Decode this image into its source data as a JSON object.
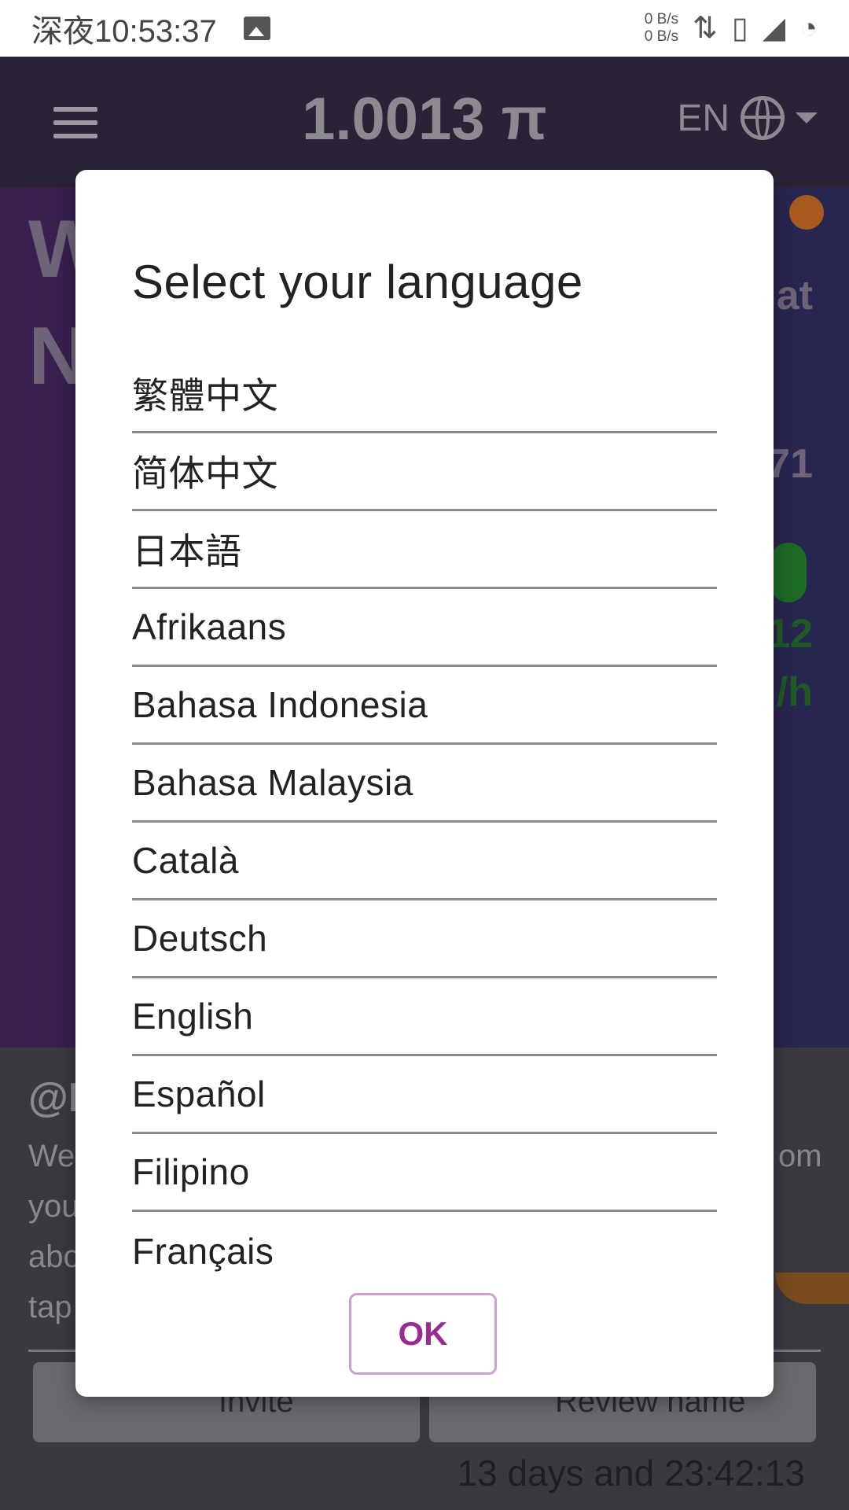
{
  "status_bar": {
    "time": "深夜10:53:37",
    "speed_up": "0 B/s",
    "speed_down": "0 B/s"
  },
  "header": {
    "balance": "1.0013 π",
    "language_code": "EN"
  },
  "background": {
    "big_line1": "W",
    "big_line2": "N",
    "side_chat": "at",
    "side_count": "71",
    "side_rate_value": "12",
    "side_rate_unit": "/h",
    "username_partial": "@P",
    "body_line1_left": "We",
    "body_line1_right": "om",
    "body_line2_left": "you",
    "body_line3_left": "abo",
    "body_line4_left": "tap",
    "invite_label": "Invite",
    "review_label": "Review name",
    "timer": "13 days and 23:42:13"
  },
  "dialog": {
    "title": "Select your language",
    "languages": [
      "繁體中文",
      "简体中文",
      "日本語",
      "Afrikaans",
      "Bahasa Indonesia",
      "Bahasa Malaysia",
      "Català",
      "Deutsch",
      "English",
      "Español",
      "Filipino",
      "Français"
    ],
    "ok_label": "OK"
  },
  "colors": {
    "accent": "#9b2b8e",
    "header_bg": "#2b2238"
  }
}
